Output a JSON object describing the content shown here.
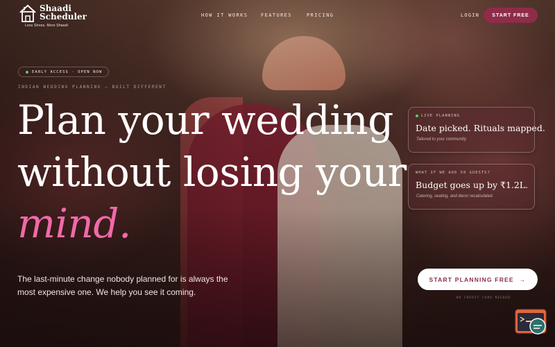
{
  "brand": {
    "name_line1": "Shaadi",
    "name_line2": "Scheduler",
    "tagline": "Less Stress. More Shaadi"
  },
  "nav": {
    "items": [
      {
        "label": "HOW IT WORKS"
      },
      {
        "label": "FEATURES"
      },
      {
        "label": "PRICING"
      }
    ],
    "login_label": "LOGIN",
    "start_free_label": "START FREE"
  },
  "hero": {
    "badge": "EARLY ACCESS · OPEN NOW",
    "eyebrow": "INDIAN WEDDING PLANNING — BUILT DIFFERENT",
    "headline_line1": "Plan your wedding",
    "headline_line2": "without losing your",
    "headline_line3": "mind.",
    "paragraph": "The last-minute change nobody planned for is always the most expensive one. We help you see it coming.",
    "cta_label": "START PLANNING FREE",
    "cta_arrow": "→",
    "cta_note": "NO CREDIT CARD NEEDED"
  },
  "cards": [
    {
      "label": "LIVE PLANNING",
      "title": "Date picked. Rituals mapped.",
      "subtitle": "Tailored to your community."
    },
    {
      "label": "WHAT IF WE ADD 50 GUESTS?",
      "title": "Budget goes up by ₹1.2L.",
      "subtitle": "Catering, seating, and decor recalculated."
    }
  ],
  "colors": {
    "accent": "#8e2c4a",
    "headline_accent": "#f06aa8",
    "live_dot": "#4bd36b"
  },
  "icons": {
    "logo": "house-logo-icon",
    "chat_widget": "chat-widget-icon"
  }
}
